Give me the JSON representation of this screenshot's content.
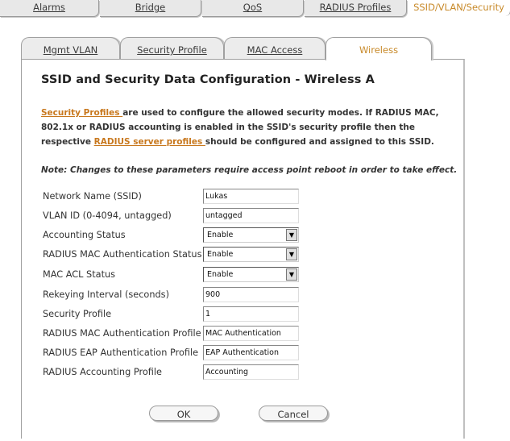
{
  "top_tabs": [
    {
      "label": "Alarms"
    },
    {
      "label": "Bridge"
    },
    {
      "label": "QoS"
    },
    {
      "label": "RADIUS Profiles"
    },
    {
      "label": "SSID/VLAN/Security"
    }
  ],
  "sub_tabs": [
    {
      "label": "Mgmt VLAN"
    },
    {
      "label": "Security Profile"
    },
    {
      "label": "MAC Access"
    },
    {
      "label": "Wireless"
    }
  ],
  "title": "SSID and Security Data Configuration - Wireless A",
  "description": {
    "link1": "Security Profiles ",
    "text1": "are used to configure the allowed security modes. If RADIUS MAC, 802.1x or RADIUS accounting is enabled in the SSID's security profile then the respective ",
    "link2": "RADIUS server profiles ",
    "text2": "should be configured and assigned to this SSID."
  },
  "note": "Note: Changes to these parameters require access point reboot in order to take effect.",
  "fields": {
    "ssid": {
      "label": "Network Name (SSID)",
      "value": "Lukas"
    },
    "vlan_id": {
      "label": "VLAN ID (0-4094, untagged)",
      "value": "untagged"
    },
    "accounting_status": {
      "label": "Accounting Status",
      "value": "Enable"
    },
    "radius_mac_auth_status": {
      "label": "RADIUS MAC Authentication Status",
      "value": "Enable"
    },
    "mac_acl_status": {
      "label": "MAC ACL Status",
      "value": "Enable"
    },
    "rekeying_interval": {
      "label": "Rekeying Interval (seconds)",
      "value": "900"
    },
    "security_profile": {
      "label": "Security Profile",
      "value": "1"
    },
    "radius_mac_auth_profile": {
      "label": "RADIUS MAC Authentication Profile",
      "value": "MAC Authentication"
    },
    "radius_eap_auth_profile": {
      "label": "RADIUS EAP Authentication Profile",
      "value": "EAP Authentication"
    },
    "radius_accounting_profile": {
      "label": "RADIUS Accounting Profile",
      "value": "Accounting"
    }
  },
  "buttons": {
    "ok": "OK",
    "cancel": "Cancel"
  },
  "colors": {
    "active_tab_text": "#c88a2a",
    "link": "#c8781e"
  }
}
